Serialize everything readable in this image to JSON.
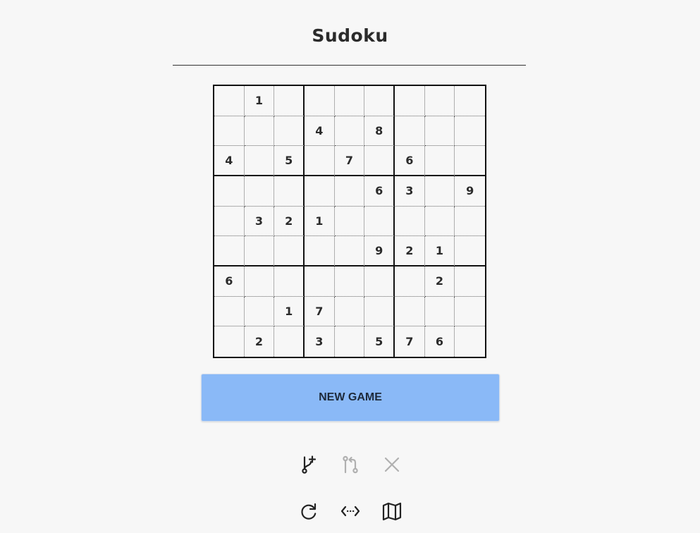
{
  "header": {
    "title": "Sudoku"
  },
  "board": {
    "grid": [
      [
        "",
        "1",
        "",
        "",
        "",
        "",
        "",
        "",
        ""
      ],
      [
        "",
        "",
        "",
        "4",
        "",
        "8",
        "",
        "",
        ""
      ],
      [
        "4",
        "",
        "5",
        "",
        "7",
        "",
        "6",
        "",
        ""
      ],
      [
        "",
        "",
        "",
        "",
        "",
        "6",
        "3",
        "",
        "9"
      ],
      [
        "",
        "3",
        "2",
        "1",
        "",
        "",
        "",
        "",
        ""
      ],
      [
        "",
        "",
        "",
        "",
        "",
        "9",
        "2",
        "1",
        ""
      ],
      [
        "6",
        "",
        "",
        "",
        "",
        "",
        "",
        "2",
        ""
      ],
      [
        "",
        "",
        "1",
        "7",
        "",
        "",
        "",
        "",
        ""
      ],
      [
        "",
        "2",
        "",
        "3",
        "",
        "5",
        "7",
        "6",
        ""
      ]
    ]
  },
  "actions": {
    "new_game_label": "NEW GAME"
  },
  "toolbar": {
    "row1": [
      {
        "icon": "branch-add-icon",
        "enabled": true
      },
      {
        "icon": "git-compare-icon",
        "enabled": false
      },
      {
        "icon": "close-icon",
        "enabled": false
      }
    ],
    "row2": [
      {
        "icon": "refresh-icon",
        "enabled": true
      },
      {
        "icon": "code-arrows-icon",
        "enabled": true
      },
      {
        "icon": "map-icon",
        "enabled": true
      }
    ]
  },
  "colors": {
    "background": "#f7f7f7",
    "button": "#8ab9f7",
    "icon_active": "#222222",
    "icon_disabled": "#b0b0b0"
  }
}
